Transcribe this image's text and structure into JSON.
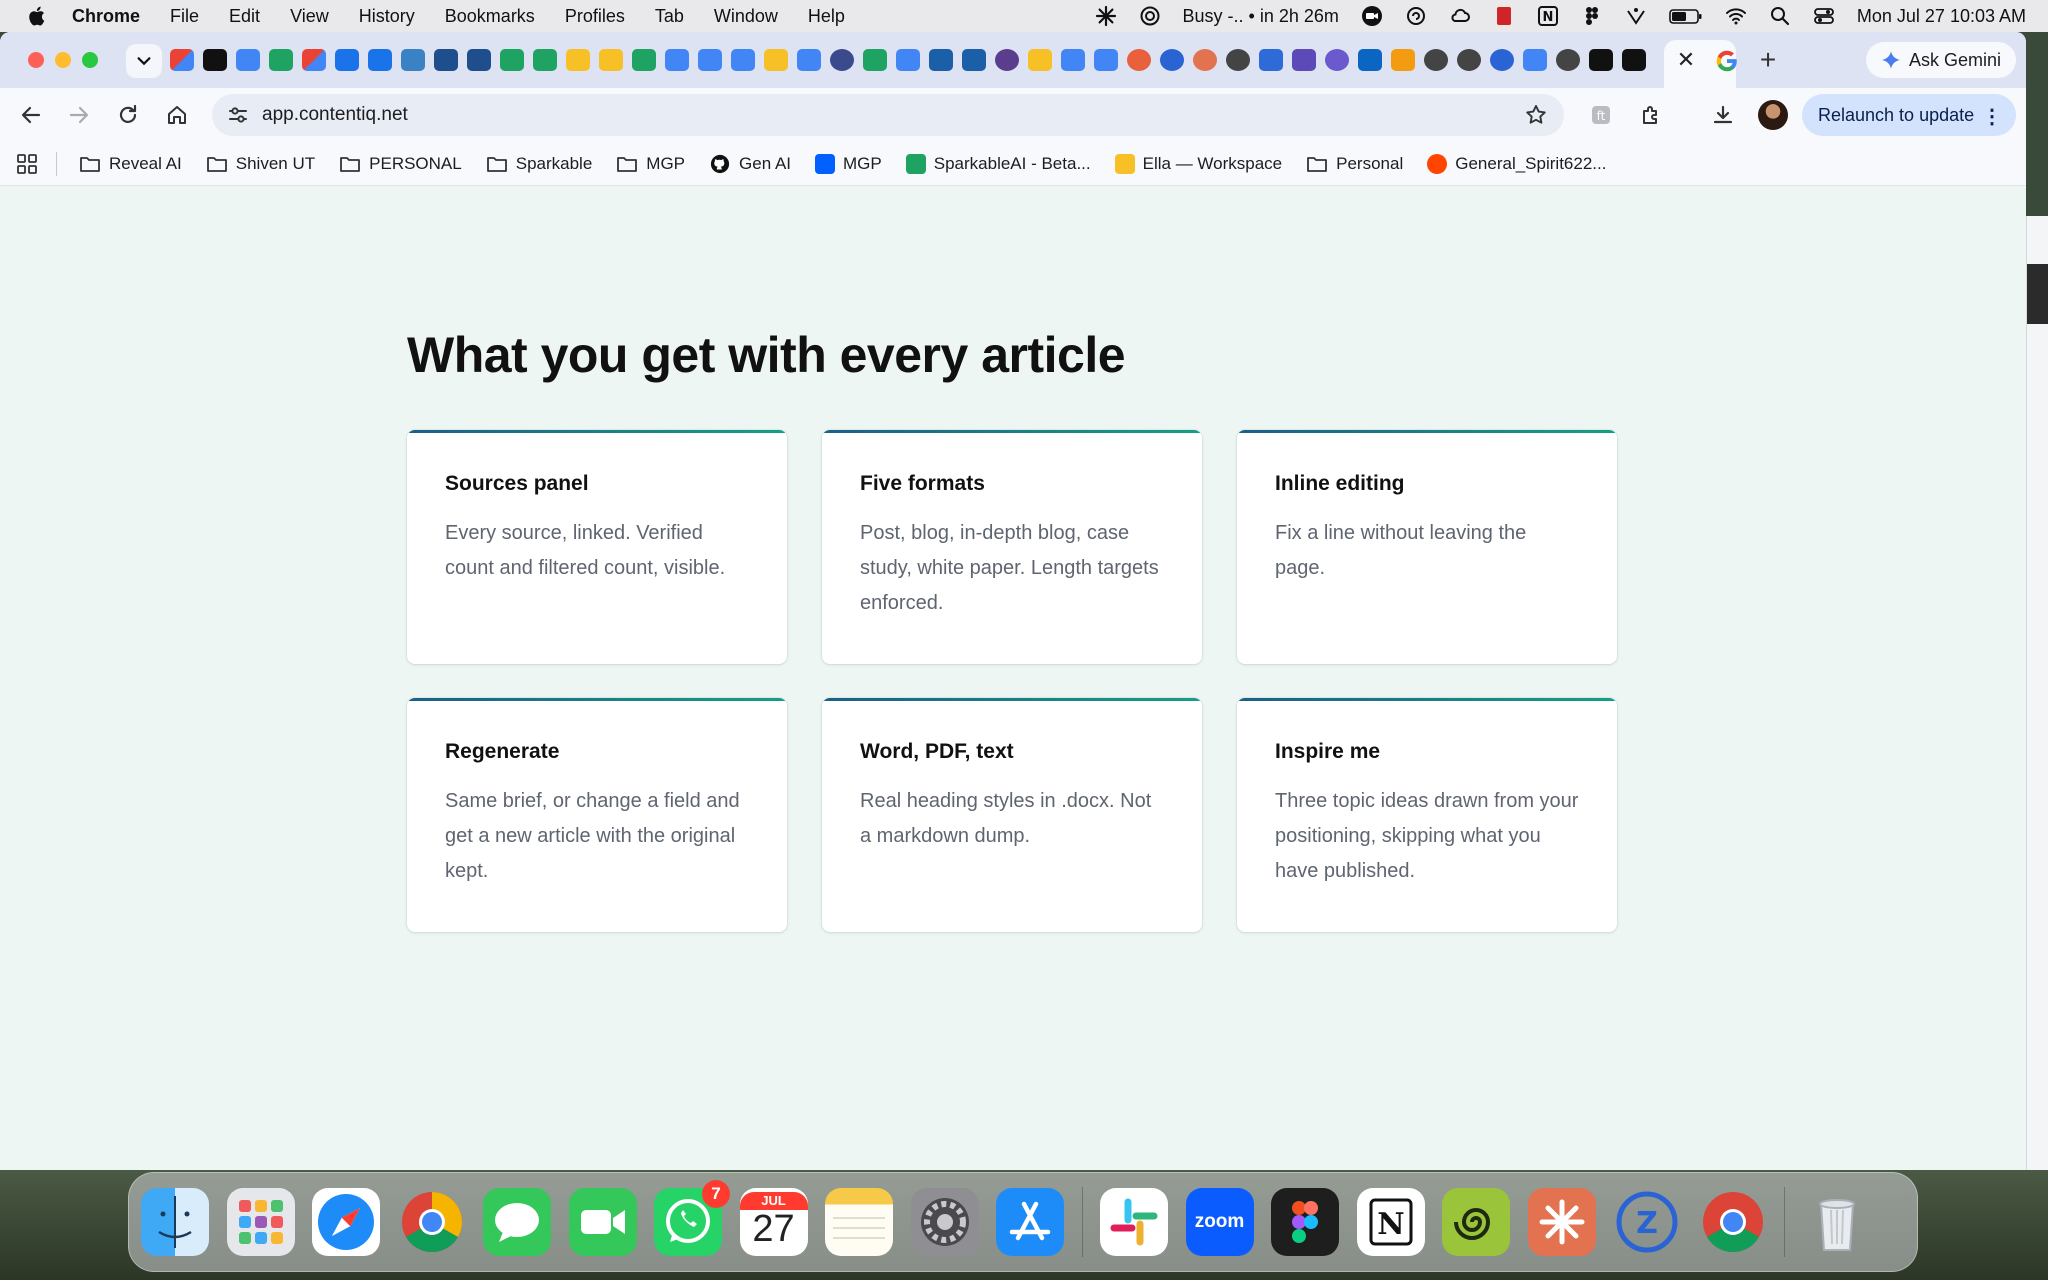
{
  "menubar": {
    "items": [
      "Chrome",
      "File",
      "Edit",
      "View",
      "History",
      "Bookmarks",
      "Profiles",
      "Tab",
      "Window",
      "Help"
    ],
    "status_busy": "Busy -.. • in 2h 26m",
    "datetime": "Mon Jul 27  10:03 AM"
  },
  "browser": {
    "ask_gemini": "Ask Gemini",
    "url": "app.contentiq.net",
    "relaunch": "Relaunch to update",
    "bookmarks": [
      "Reveal AI",
      "Shiven UT",
      "PERSONAL",
      "Sparkable",
      "MGP",
      "Gen AI",
      "MGP",
      "SparkableAI - Beta...",
      "Ella — Workspace",
      "Personal",
      "General_Spirit622..."
    ]
  },
  "page": {
    "headline": "What you get with every article",
    "cards": [
      {
        "title": "Sources panel",
        "body": "Every source, linked. Verified count and filtered count, visible."
      },
      {
        "title": "Five formats",
        "body": "Post, blog, in-depth blog, case study, white paper. Length targets enforced."
      },
      {
        "title": "Inline editing",
        "body": "Fix a line without leaving the page."
      },
      {
        "title": "Regenerate",
        "body": "Same brief, or change a field and get a new article with the original kept."
      },
      {
        "title": "Word, PDF, text",
        "body": "Real heading styles in .docx. Not a markdown dump."
      },
      {
        "title": "Inspire me",
        "body": "Three topic ideas drawn from your positioning, skipping what you have published."
      }
    ]
  },
  "dock": {
    "whatsapp_badge": "7",
    "calendar_month": "JUL",
    "calendar_day": "27",
    "zoom_label": "zoom"
  },
  "colors": {
    "page_bg": "#eef6f3",
    "card_accent_start": "#1b5f86",
    "card_accent_end": "#179e84",
    "relaunch_bg": "#d3e3fd"
  }
}
